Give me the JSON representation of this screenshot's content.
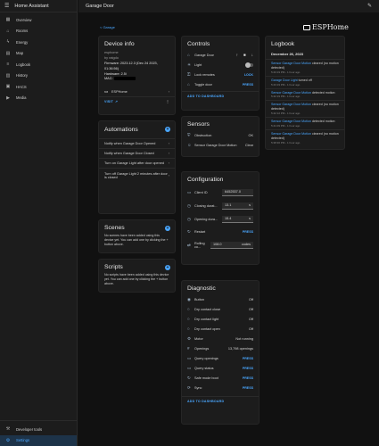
{
  "app": {
    "title": "Home Assistant",
    "page_title": "Garage Door",
    "breadcrumb": "< Garage",
    "brand": "ESPHome"
  },
  "sidebar": {
    "items": [
      {
        "label": "Overview",
        "icon": "grid-icon"
      },
      {
        "label": "Rooms",
        "icon": "home-icon"
      },
      {
        "label": "Energy",
        "icon": "bolt-icon"
      },
      {
        "label": "Map",
        "icon": "map-icon"
      },
      {
        "label": "Logbook",
        "icon": "list-icon"
      },
      {
        "label": "History",
        "icon": "chart-icon"
      },
      {
        "label": "HACS",
        "icon": "hacs-icon"
      },
      {
        "label": "Media",
        "icon": "media-icon"
      }
    ],
    "bottom": [
      {
        "label": "Developer tools",
        "icon": "wrench-icon"
      },
      {
        "label": "Settings",
        "icon": "gear-icon"
      }
    ]
  },
  "device_info": {
    "title": "Device info",
    "model": "esphome",
    "by": "by ratgdo",
    "firmware": "Firmware: 2023.12.3 (Dec 24 2023, 01:36:56)",
    "hardware": "Hardware: 2.5i",
    "mac_label": "MAC: ",
    "integration": "ESPHome",
    "visit": "VISIT"
  },
  "automations": {
    "title": "Automations",
    "items": [
      "Notify when Garage Door Opened",
      "Notify when Garage Door Closed",
      "Turn on Garage Light after door opened",
      "Turn off Garage Light 2 minutes after door is closed"
    ]
  },
  "scenes": {
    "title": "Scenes",
    "text": "No scenes have been added using this device yet. You can add one by clicking the + button above."
  },
  "scripts": {
    "title": "Scripts",
    "text": "No scripts have been added using this device yet. You can add one by clicking the + button above."
  },
  "controls": {
    "title": "Controls",
    "rows": [
      {
        "label": "Garage Door",
        "icon": "garage-icon"
      },
      {
        "label": "Light",
        "icon": "bulb-icon"
      },
      {
        "label": "Lock remotes",
        "icon": "lock-icon",
        "action": "LOCK"
      },
      {
        "label": "Toggle door",
        "icon": "garage-icon",
        "action": "PRESS"
      }
    ],
    "footer": "ADD TO DASHBOARD"
  },
  "sensors": {
    "title": "Sensors",
    "rows": [
      {
        "label": "Obstruction",
        "icon": "shield-icon",
        "value": "OK"
      },
      {
        "label": "Sensor Garage Door Motion",
        "icon": "motion-icon",
        "value": "Clear"
      }
    ]
  },
  "configuration": {
    "title": "Configuration",
    "rows": [
      {
        "label": "Client ID",
        "icon": "id-icon",
        "value": "6452537.0"
      },
      {
        "label": "Closing durat...",
        "icon": "timer-icon",
        "value": "13.1",
        "unit": "s"
      },
      {
        "label": "Opening dura...",
        "icon": "timer-icon",
        "value": "15.4",
        "unit": "s"
      },
      {
        "label": "Restart",
        "icon": "restart-icon",
        "action": "PRESS"
      },
      {
        "label": "Rolling co...",
        "icon": "counter-icon",
        "value": "108.0",
        "unit": "codes"
      }
    ]
  },
  "diagnostic": {
    "title": "Diagnostic",
    "rows": [
      {
        "label": "Button",
        "icon": "button-icon",
        "value": "Off"
      },
      {
        "label": "Dry contact close",
        "icon": "contact-icon",
        "value": "Off"
      },
      {
        "label": "Dry contact light",
        "icon": "contact-icon",
        "value": "Off"
      },
      {
        "label": "Dry contact open",
        "icon": "contact-icon",
        "value": "Off"
      },
      {
        "label": "Motor",
        "icon": "motor-icon",
        "value": "Not running"
      },
      {
        "label": "Openings",
        "icon": "counter-icon",
        "value": "13,798 openings"
      },
      {
        "label": "Query openings",
        "icon": "query-icon",
        "action": "PRESS"
      },
      {
        "label": "Query status",
        "icon": "query-icon",
        "action": "PRESS"
      },
      {
        "label": "Safe mode boot",
        "icon": "restart-icon",
        "action": "PRESS"
      },
      {
        "label": "Sync",
        "icon": "sync-icon",
        "action": "PRESS"
      }
    ],
    "footer": "ADD TO DASHBOARD"
  },
  "logbook": {
    "title": "Logbook",
    "date": "December 26, 2023",
    "entries": [
      {
        "entity": "Sensor Garage Door Motion",
        "text": " cleared (no motion detected)",
        "time": "5:43:19 PM - 1 hour ago"
      },
      {
        "entity": "Garage Door Light",
        "text": " turned off",
        "time": "5:43:19 PM - 1 hour ago"
      },
      {
        "entity": "Sensor Garage Door Motion",
        "text": " detected motion",
        "time": "5:42:19 PM - 1 hour ago"
      },
      {
        "entity": "Sensor Garage Door Motion",
        "text": " cleared (no motion detected)",
        "time": "5:42:12 PM - 1 hour ago"
      },
      {
        "entity": "Sensor Garage Door Motion",
        "text": " detected motion",
        "time": "5:41:09 PM - 1 hour ago"
      },
      {
        "entity": "Sensor Garage Door Motion",
        "text": " cleared (no motion detected)",
        "time": "5:38:30 PM - 1 hour ago"
      }
    ]
  },
  "colors": {
    "accent": "#4aa7ff",
    "background": "#111111",
    "card": "#1c1c1c"
  }
}
